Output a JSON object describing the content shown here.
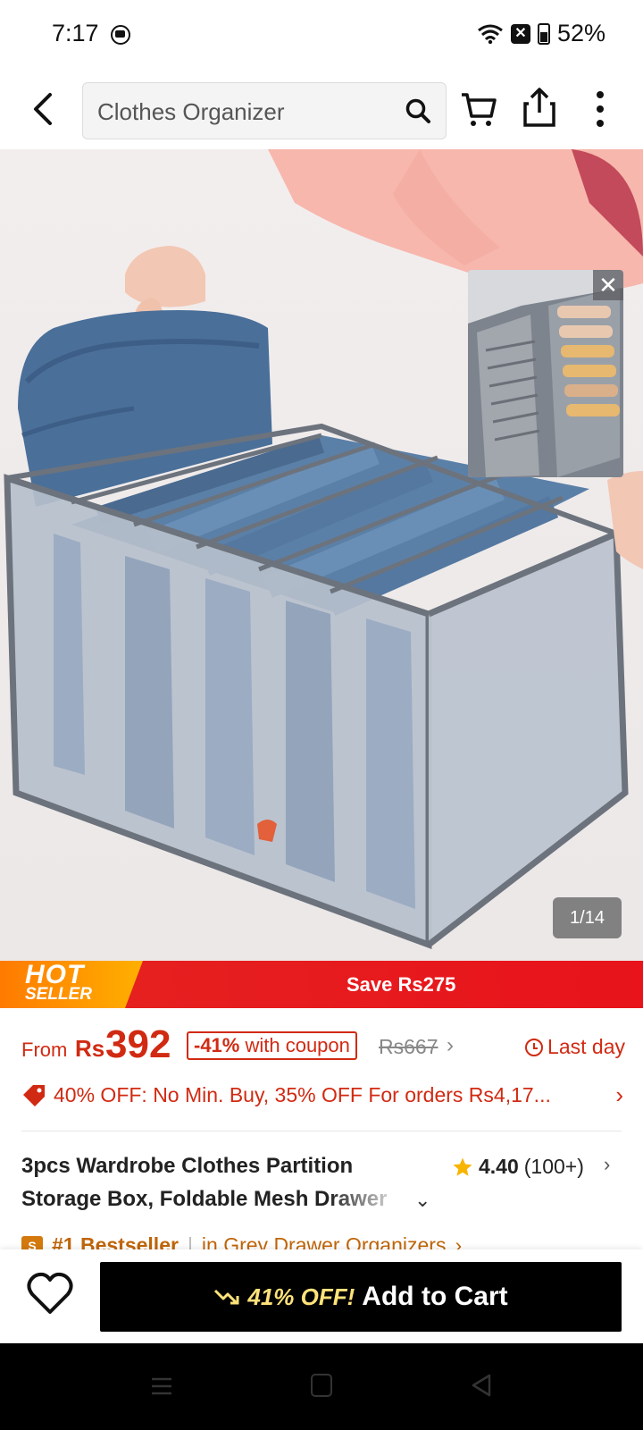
{
  "status_bar": {
    "time": "7:17",
    "battery": "52%",
    "battery_level": 0.52
  },
  "header": {
    "search_value": "Clothes Organizer"
  },
  "gallery": {
    "counter": "1/14"
  },
  "promo": {
    "hot": "HOT",
    "seller": "SELLER",
    "save": "Save Rs275"
  },
  "price": {
    "from": "From",
    "currency": "Rs",
    "value": "392",
    "coupon_pct": "-41%",
    "coupon_text": " with coupon",
    "original": "Rs667",
    "last_day": "Last day"
  },
  "offer": {
    "text": "40% OFF: No Min. Buy,  35% OFF For orders Rs4,17..."
  },
  "product": {
    "title_line1": "3pcs Wardrobe Clothes Partition",
    "title_line2": "Storage Box, Foldable Mesh Drawer",
    "rating": "4.40",
    "rating_count": "(100+)"
  },
  "bestseller": {
    "rank": "#1 Bestseller",
    "category": "in Grey Drawer Organizers"
  },
  "action": {
    "discount": "41% OFF!",
    "add_to_cart": "Add to Cart"
  },
  "colors": {
    "brand_red": "#d12a12",
    "banner_red": "#e8131b",
    "hot_orange": "#ff9a00",
    "cart_button": "#000000"
  }
}
